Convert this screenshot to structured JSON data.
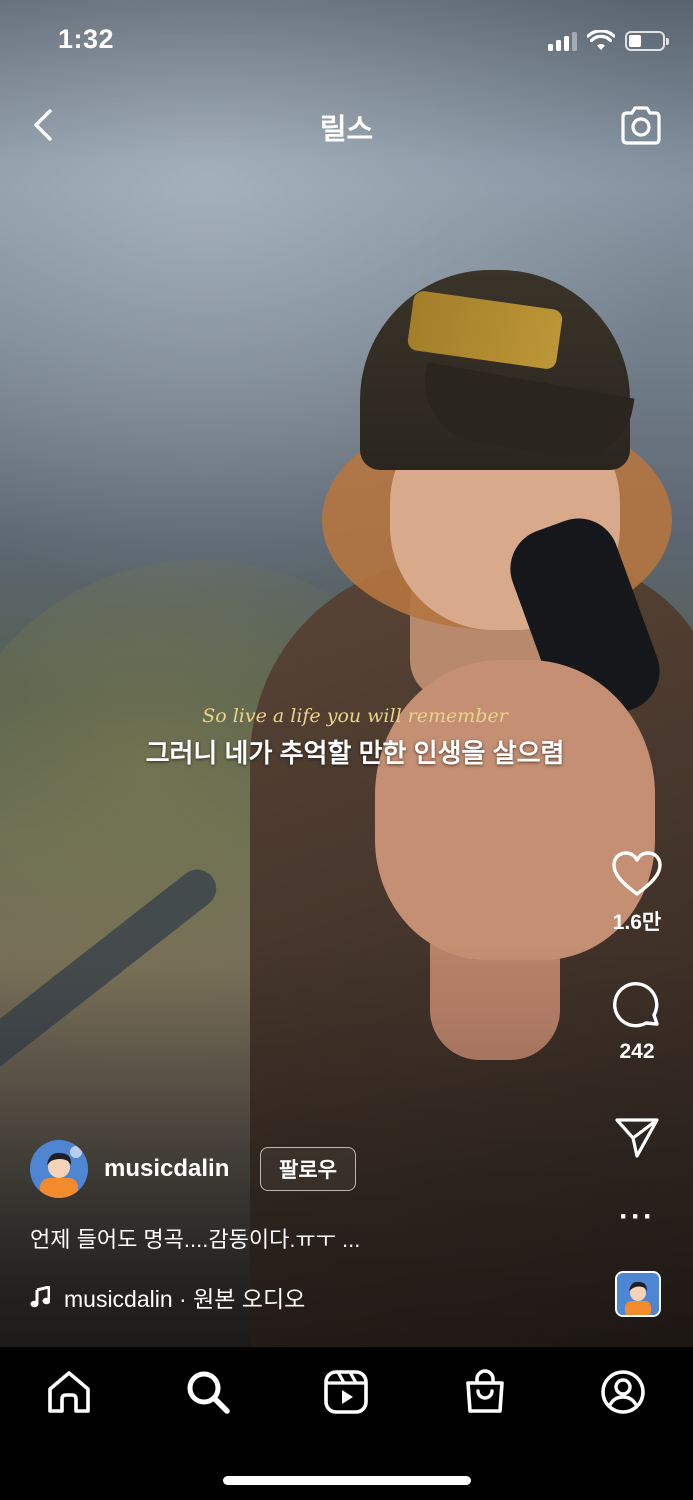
{
  "status_bar": {
    "time": "1:32",
    "signal_bars": 3,
    "battery_level": 0.35
  },
  "header": {
    "title": "릴스",
    "back_icon": "chevron-left-icon",
    "camera_icon": "camera-icon"
  },
  "subtitles": {
    "english": "So live a life you will remember",
    "korean": "그러니 네가 추억할 만한 인생을 살으렴"
  },
  "actions": {
    "like_count": "1.6만",
    "comment_count": "242",
    "share_icon": "paper-plane-icon",
    "more_label": "···"
  },
  "post": {
    "username": "musicdalin",
    "follow_label": "팔로우",
    "caption": "언제 들어도 명곡....감동이다.ㅠㅜ ...",
    "audio": "musicdalin · 원본 오디오"
  },
  "tabbar": {
    "tabs": [
      "home-icon",
      "search-icon",
      "reels-icon",
      "shop-icon",
      "profile-icon"
    ],
    "active_tab": "search-icon"
  },
  "colors": {
    "subtitle_english": "#e9d48a",
    "background": "#000000"
  }
}
